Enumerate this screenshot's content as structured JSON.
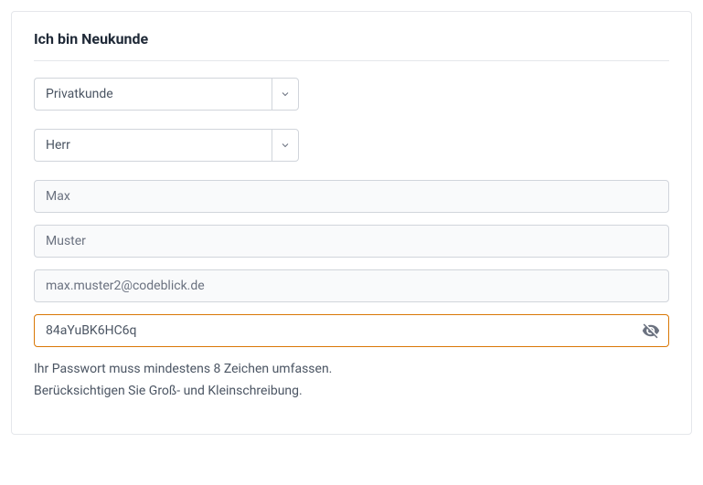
{
  "title": "Ich bin Neukunde",
  "customerType": {
    "selected": "Privatkunde"
  },
  "salutation": {
    "selected": "Herr"
  },
  "firstName": {
    "value": "Max"
  },
  "lastName": {
    "value": "Muster"
  },
  "email": {
    "value": "max.muster2@codeblick.de"
  },
  "password": {
    "value": "84aYuBK6HC6q"
  },
  "helpLine1": "Ihr Passwort muss mindestens 8 Zeichen umfassen.",
  "helpLine2": "Berücksichtigen Sie Groß- und Kleinschreibung."
}
